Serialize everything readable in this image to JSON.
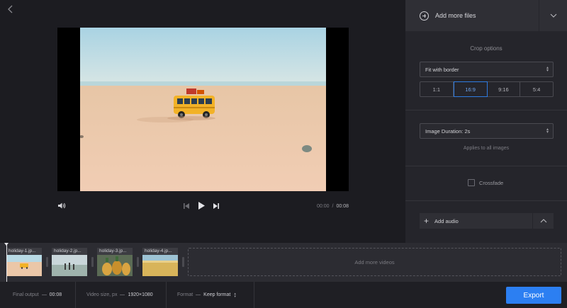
{
  "sidebar": {
    "add_files_label": "Add more files",
    "crop_title": "Crop options",
    "crop_mode": "Fit with border",
    "ratios": [
      {
        "label": "1:1",
        "active": false
      },
      {
        "label": "16:9",
        "active": true
      },
      {
        "label": "9:16",
        "active": false
      },
      {
        "label": "5:4",
        "active": false
      }
    ],
    "image_duration": "Image Duration: 2s",
    "duration_hint": "Applies to all images",
    "crossfade_label": "Crossfade",
    "crossfade_checked": false,
    "add_audio_label": "Add audio"
  },
  "player": {
    "current_time": "00:00",
    "separator": "/",
    "total_time": "00:08"
  },
  "timeline": {
    "clips": [
      {
        "name": "holiday-1.jp..."
      },
      {
        "name": "holiday-2.jp..."
      },
      {
        "name": "holiday-3.jp..."
      },
      {
        "name": "holiday-4.jp..."
      }
    ],
    "add_videos_label": "Add more videos"
  },
  "footer": {
    "final_output_label": "Final output",
    "final_output_value": "00:08",
    "video_size_label": "Video size, px",
    "video_size_value": "1920×1080",
    "format_label": "Format",
    "format_value": "Keep format",
    "export_label": "Export"
  },
  "colors": {
    "accent": "#2c7ff2",
    "active_ratio": "#2f7be0",
    "background": "#1b1b1f",
    "sidebar": "#25252b"
  },
  "icons": [
    "back-arrow-icon",
    "plus-circle-icon",
    "chevron-down-icon",
    "volume-icon",
    "skip-back-icon",
    "play-icon",
    "skip-forward-icon",
    "plus-icon",
    "chevron-up-icon"
  ]
}
